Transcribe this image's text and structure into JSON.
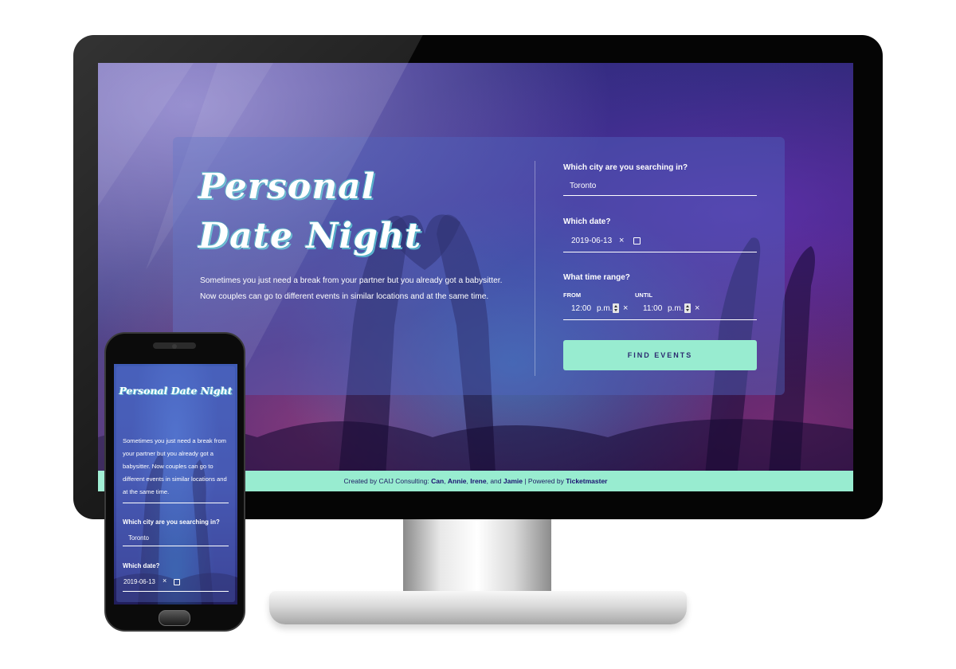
{
  "colors": {
    "accent": "#98ecd0",
    "footer_text": "#1e1b63",
    "button_text": "#2c2a70",
    "hero_outline": "#5fb7d0"
  },
  "desktop": {
    "hero": {
      "title_line1": "Personal",
      "title_line2": "Date Night",
      "description": "Sometimes you just need a break from your partner but you already got a babysitter. Now couples can go to different events in similar locations and at the same time."
    },
    "form": {
      "city_label": "Which city are you searching in?",
      "city_value": "Toronto",
      "date_label": "Which date?",
      "date_value": "2019-06-13",
      "time_label": "What time range?",
      "from_label": "FROM",
      "from_time": "12:00",
      "from_period": "p.m.",
      "until_label": "UNTIL",
      "until_time": "11:00",
      "until_period": "p.m.",
      "clear_glyph": "×",
      "submit_label": "FIND EVENTS"
    },
    "footer": {
      "prefix": "Created by CAIJ Consulting: ",
      "name1": "Can",
      "sep1": ", ",
      "name2": "Annie",
      "sep2": ", ",
      "name3": "Irene",
      "sep3": ", and ",
      "name4": "Jamie",
      "sep4": " | Powered by ",
      "powered": "Ticketmaster"
    }
  },
  "mobile": {
    "title": "Personal Date Night",
    "description": "Sometimes you just need a break from your partner but you already got a babysitter. Now couples can go to different events in similar locations and at the same time.",
    "city_label": "Which city are you searching in?",
    "city_value": "Toronto",
    "date_label": "Which date?",
    "date_value": "2019-06-13",
    "clear_glyph": "×"
  }
}
